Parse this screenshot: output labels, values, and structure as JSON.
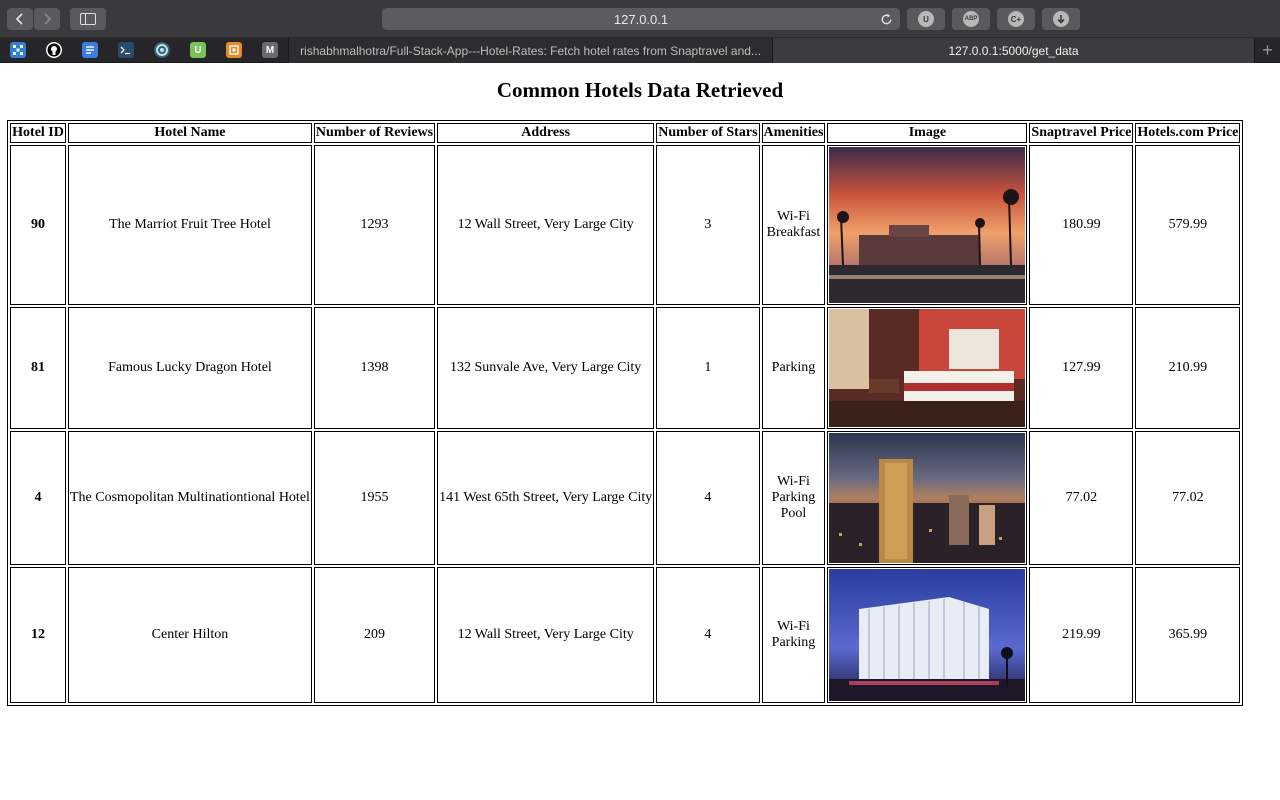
{
  "browser": {
    "url": "127.0.0.1",
    "tabs": [
      {
        "label": "rishabhmalhotra/Full-Stack-App---Hotel-Rates: Fetch hotel rates from Snaptravel and..."
      },
      {
        "label": "127.0.0.1:5000/get_data"
      }
    ],
    "extensions": [
      "U",
      "ABP",
      "C+",
      "download-icon"
    ],
    "favorites": [
      {
        "icon": "grid-icon",
        "color": "#2f7fd8"
      },
      {
        "icon": "github-icon",
        "color": "#ffffff"
      },
      {
        "icon": "docs-icon",
        "color": "#3b7de0"
      },
      {
        "icon": "terminal-icon",
        "color": "#2a4a6e"
      },
      {
        "icon": "swirl-icon",
        "color": "#7fb0c8"
      },
      {
        "icon": "u-icon",
        "color": "#78c257"
      },
      {
        "icon": "cube-icon",
        "color": "#e88a2a"
      },
      {
        "icon": "m-icon",
        "color": "#6a6a6e"
      }
    ],
    "favorite_letters": {
      "u": "U",
      "m": "M"
    }
  },
  "page": {
    "title": "Common Hotels Data Retrieved"
  },
  "table": {
    "headers": [
      "Hotel ID",
      "Hotel Name",
      "Number of Reviews",
      "Address",
      "Number of Stars",
      "Amenities",
      "Image",
      "Snaptravel Price",
      "Hotels.com Price"
    ],
    "rows": [
      {
        "id": "90",
        "name": "The Marriot Fruit Tree Hotel",
        "reviews": "1293",
        "address": "12 Wall Street, Very Large City",
        "stars": "3",
        "amenities": [
          "Wi-Fi",
          "Breakfast"
        ],
        "image": "sunset-resort-photo",
        "snaptravel": "180.99",
        "hotels_com": "579.99"
      },
      {
        "id": "81",
        "name": "Famous Lucky Dragon Hotel",
        "reviews": "1398",
        "address": "132 Sunvale Ave, Very Large City",
        "stars": "1",
        "amenities": [
          "Parking"
        ],
        "image": "hotel-bedroom-photo",
        "snaptravel": "127.99",
        "hotels_com": "210.99"
      },
      {
        "id": "4",
        "name": "The Cosmopolitan Multinationtional Hotel",
        "reviews": "1955",
        "address": "141 West 65th Street, Very Large City",
        "stars": "4",
        "amenities": [
          "Wi-Fi",
          "Parking",
          "Pool"
        ],
        "image": "city-tower-night-photo",
        "snaptravel": "77.02",
        "hotels_com": "77.02"
      },
      {
        "id": "12",
        "name": "Center Hilton",
        "reviews": "209",
        "address": "12 Wall Street, Very Large City",
        "stars": "4",
        "amenities": [
          "Wi-Fi",
          "Parking"
        ],
        "image": "hotel-building-dusk-photo",
        "snaptravel": "219.99",
        "hotels_com": "365.99"
      }
    ]
  }
}
